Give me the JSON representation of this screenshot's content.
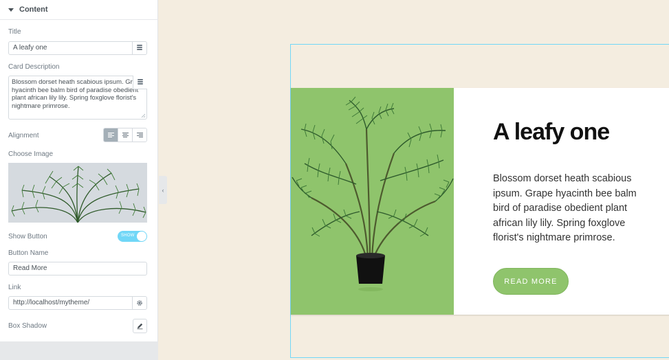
{
  "panel": {
    "section_title": "Content",
    "title_label": "Title",
    "title_value": "A leafy one",
    "description_label": "Card Description",
    "description_value": "Blossom dorset heath scabious ipsum. Grape hyacinth bee balm bird of paradise obedient plant african lily lily. Spring foxglove florist's nightmare primrose.",
    "alignment_label": "Alignment",
    "alignment_options": [
      "left",
      "center",
      "right"
    ],
    "alignment_selected": "left",
    "choose_image_label": "Choose Image",
    "show_button_label": "Show Button",
    "show_button_toggle": "SHOW",
    "button_name_label": "Button Name",
    "button_name_value": "Read More",
    "link_label": "Link",
    "link_value": "http://localhost/mytheme/",
    "box_shadow_label": "Box Shadow"
  },
  "card": {
    "title": "A leafy one",
    "description": "Blossom dorset heath scabious ipsum. Grape hyacinth bee balm bird of paradise obedient plant african lily lily. Spring foxglove florist's nightmare primrose.",
    "button_label": "READ MORE"
  },
  "icons": [
    "caret-down-icon",
    "database-icon",
    "align-left-icon",
    "align-center-icon",
    "align-right-icon",
    "gear-icon",
    "pencil-icon",
    "chevron-left-icon",
    "palm-plant-image"
  ],
  "colors": {
    "accent_green": "#8fc46c",
    "toggle_blue": "#71d7f7",
    "canvas_bg": "#f4ede0"
  }
}
